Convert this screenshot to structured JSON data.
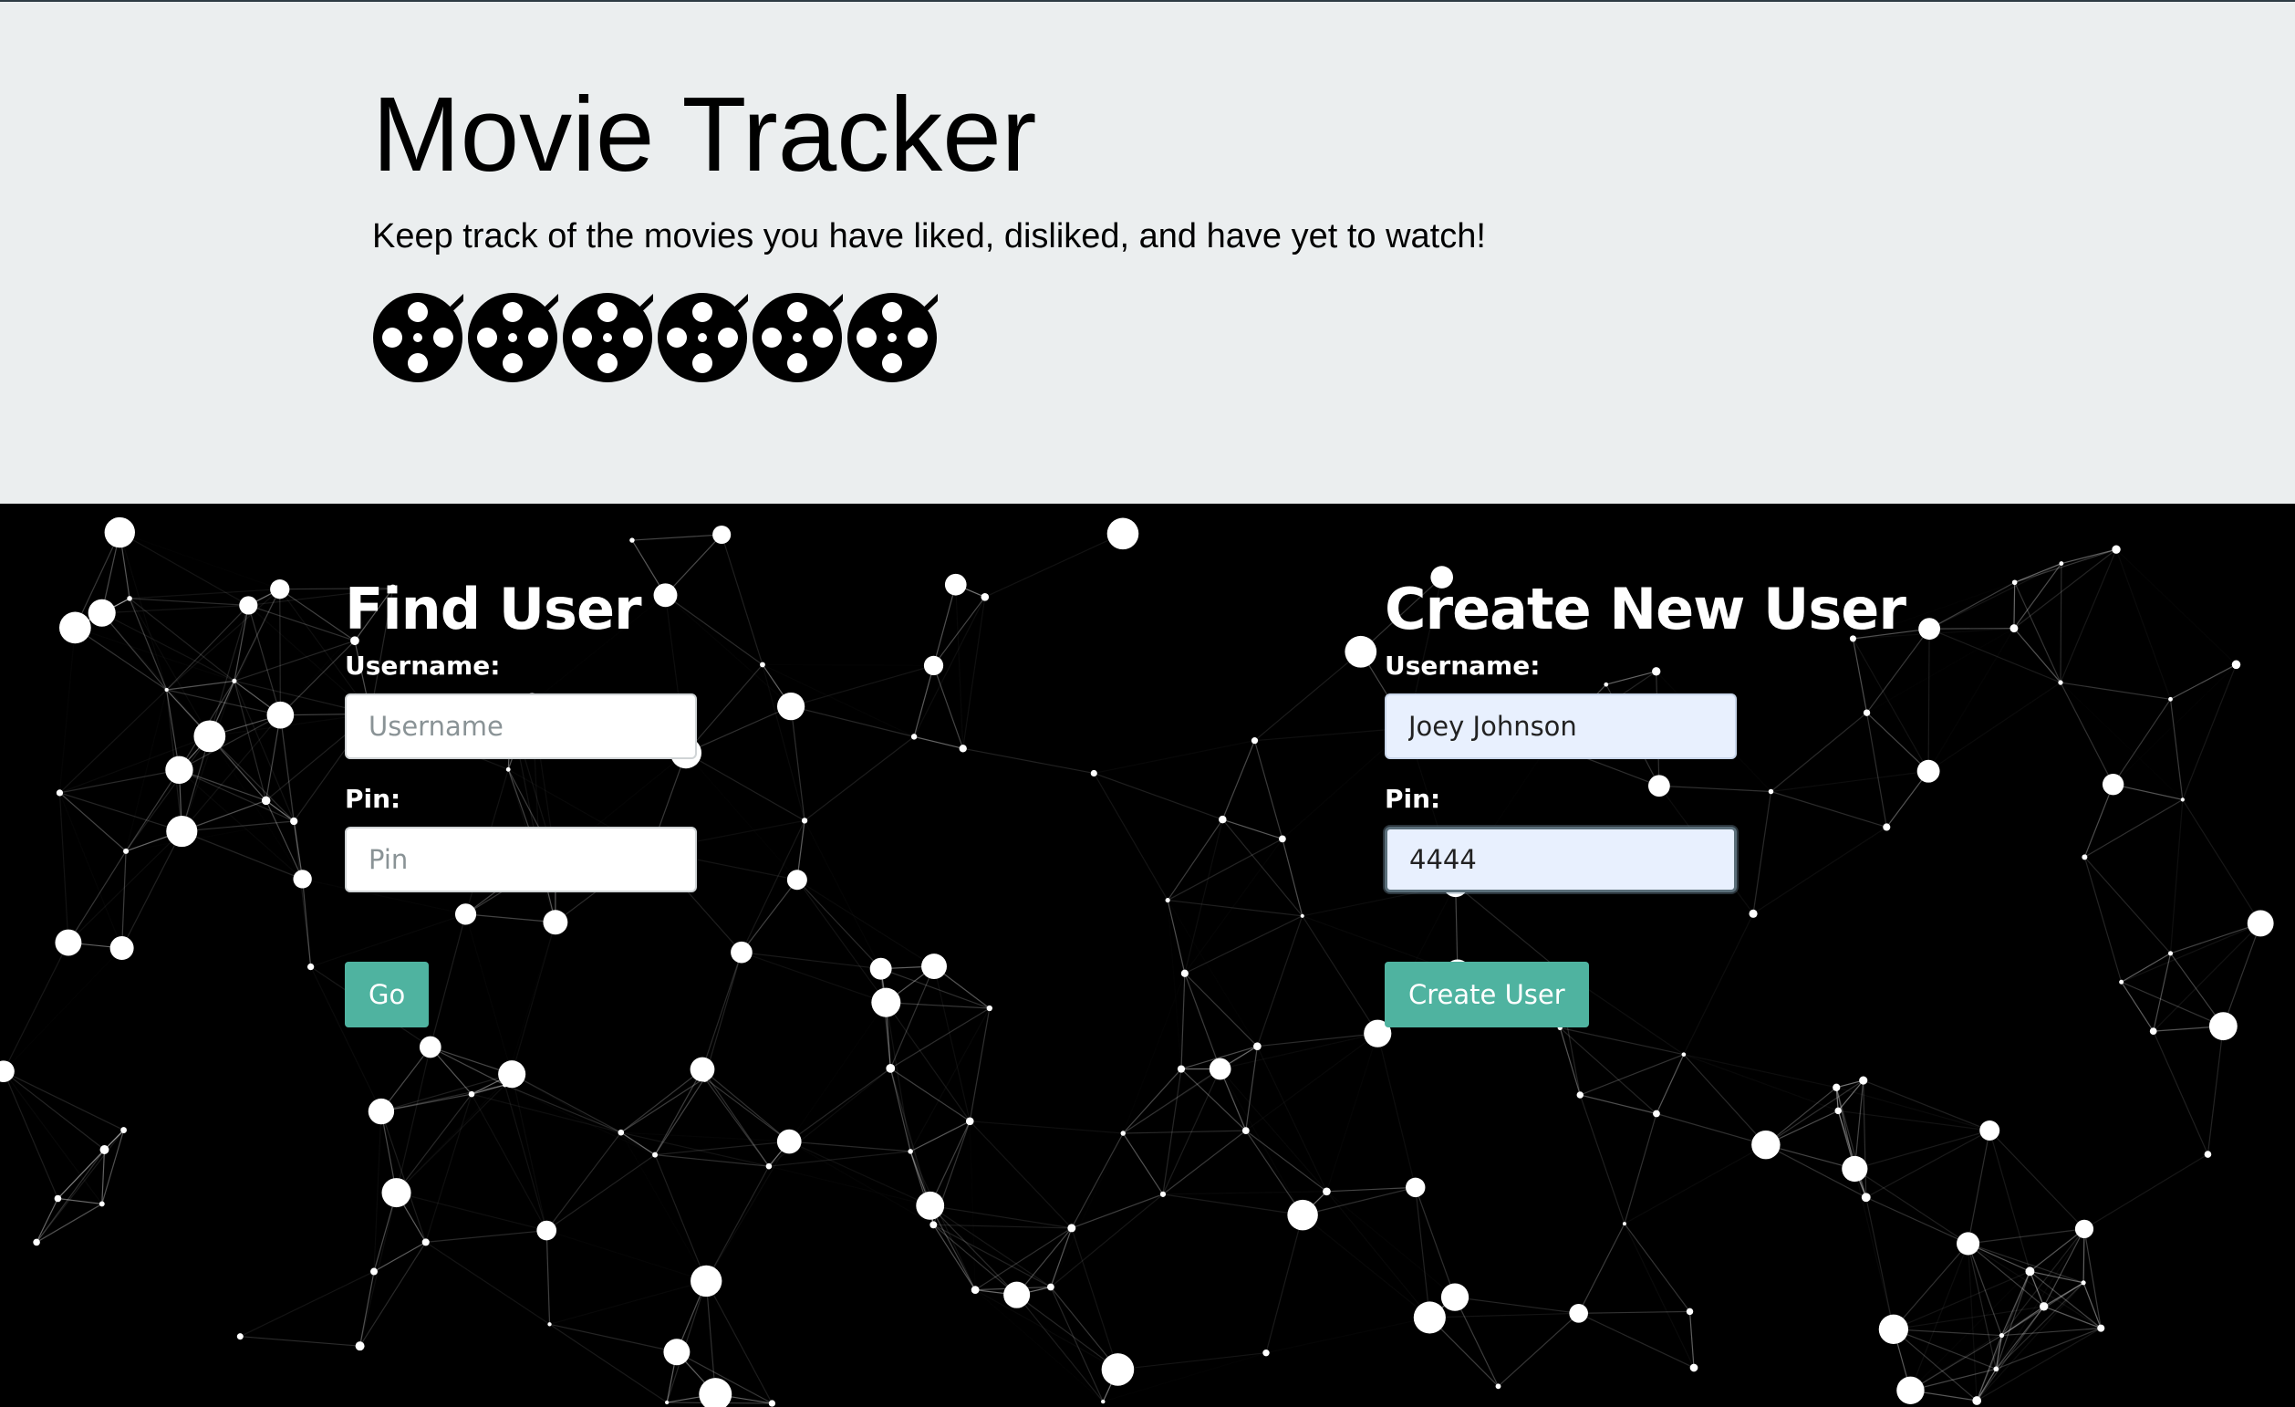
{
  "header": {
    "title": "Movie Tracker",
    "subtitle": "Keep track of the movies you have liked, disliked, and have yet to watch!",
    "reel_icons": [
      "film-reel-icon",
      "film-reel-icon",
      "film-reel-icon",
      "film-reel-icon",
      "film-reel-icon",
      "film-reel-icon"
    ]
  },
  "find_user": {
    "heading": "Find User",
    "username_label": "Username:",
    "username_placeholder": "Username",
    "username_value": "",
    "pin_label": "Pin:",
    "pin_placeholder": "Pin",
    "pin_value": "",
    "submit_label": "Go"
  },
  "create_user": {
    "heading": "Create New User",
    "username_label": "Username:",
    "username_value": "Joey Johnson",
    "pin_label": "Pin:",
    "pin_value": "4444",
    "submit_label": "Create User"
  },
  "colors": {
    "header_bg": "#ebeeef",
    "body_bg": "#000000",
    "button": "#4fb3a0",
    "autofill_bg": "#e8f0fe"
  }
}
